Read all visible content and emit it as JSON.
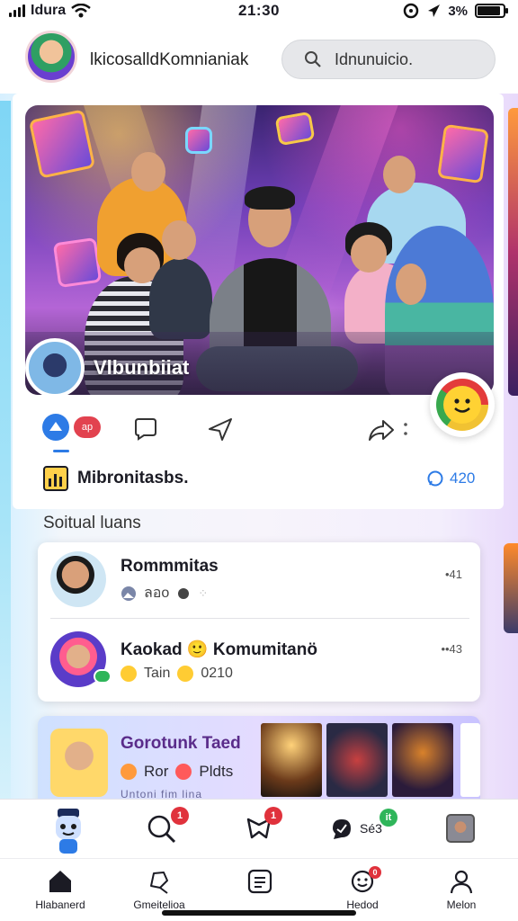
{
  "status": {
    "carrier": "Idura",
    "time": "21:30",
    "battery": "3%",
    "battery_level": 0.9
  },
  "header": {
    "app_name": "lkicosalldKomnianiak",
    "search_placeholder": "Idnunuicio."
  },
  "hero": {
    "title": "Vlbunbiiat"
  },
  "actions": {
    "red_pill": "ар"
  },
  "community": {
    "label": "Mibronitasbs.",
    "count": "420"
  },
  "social": {
    "section_title": "Soitual luans",
    "items": [
      {
        "title": "Rommmitas",
        "sub": "ลอo",
        "time": "•41"
      },
      {
        "title": "Kaokad 🙂 Komumitanö",
        "sub_a": "Tain",
        "sub_b": "0210",
        "time": "••43"
      }
    ]
  },
  "promo": {
    "title": "Gorotunk Taed",
    "sub_a": "Ror",
    "sub_b": "Pldts",
    "caption": "Untoni fim lina"
  },
  "iconbar": {
    "badge_1": "1",
    "badge_2": "1",
    "badge_3": "it",
    "label_3": "Sé3"
  },
  "tabs": [
    {
      "label": "Hlabanerd"
    },
    {
      "label": "Gmeitelioa"
    },
    {
      "label": ""
    },
    {
      "label": "Hedod"
    },
    {
      "label": "Melon"
    }
  ],
  "colors": {
    "accent": "#2d7be6",
    "badge_red": "#e0323c",
    "badge_green": "#2fb55a",
    "promo_title": "#5a2c8a"
  }
}
